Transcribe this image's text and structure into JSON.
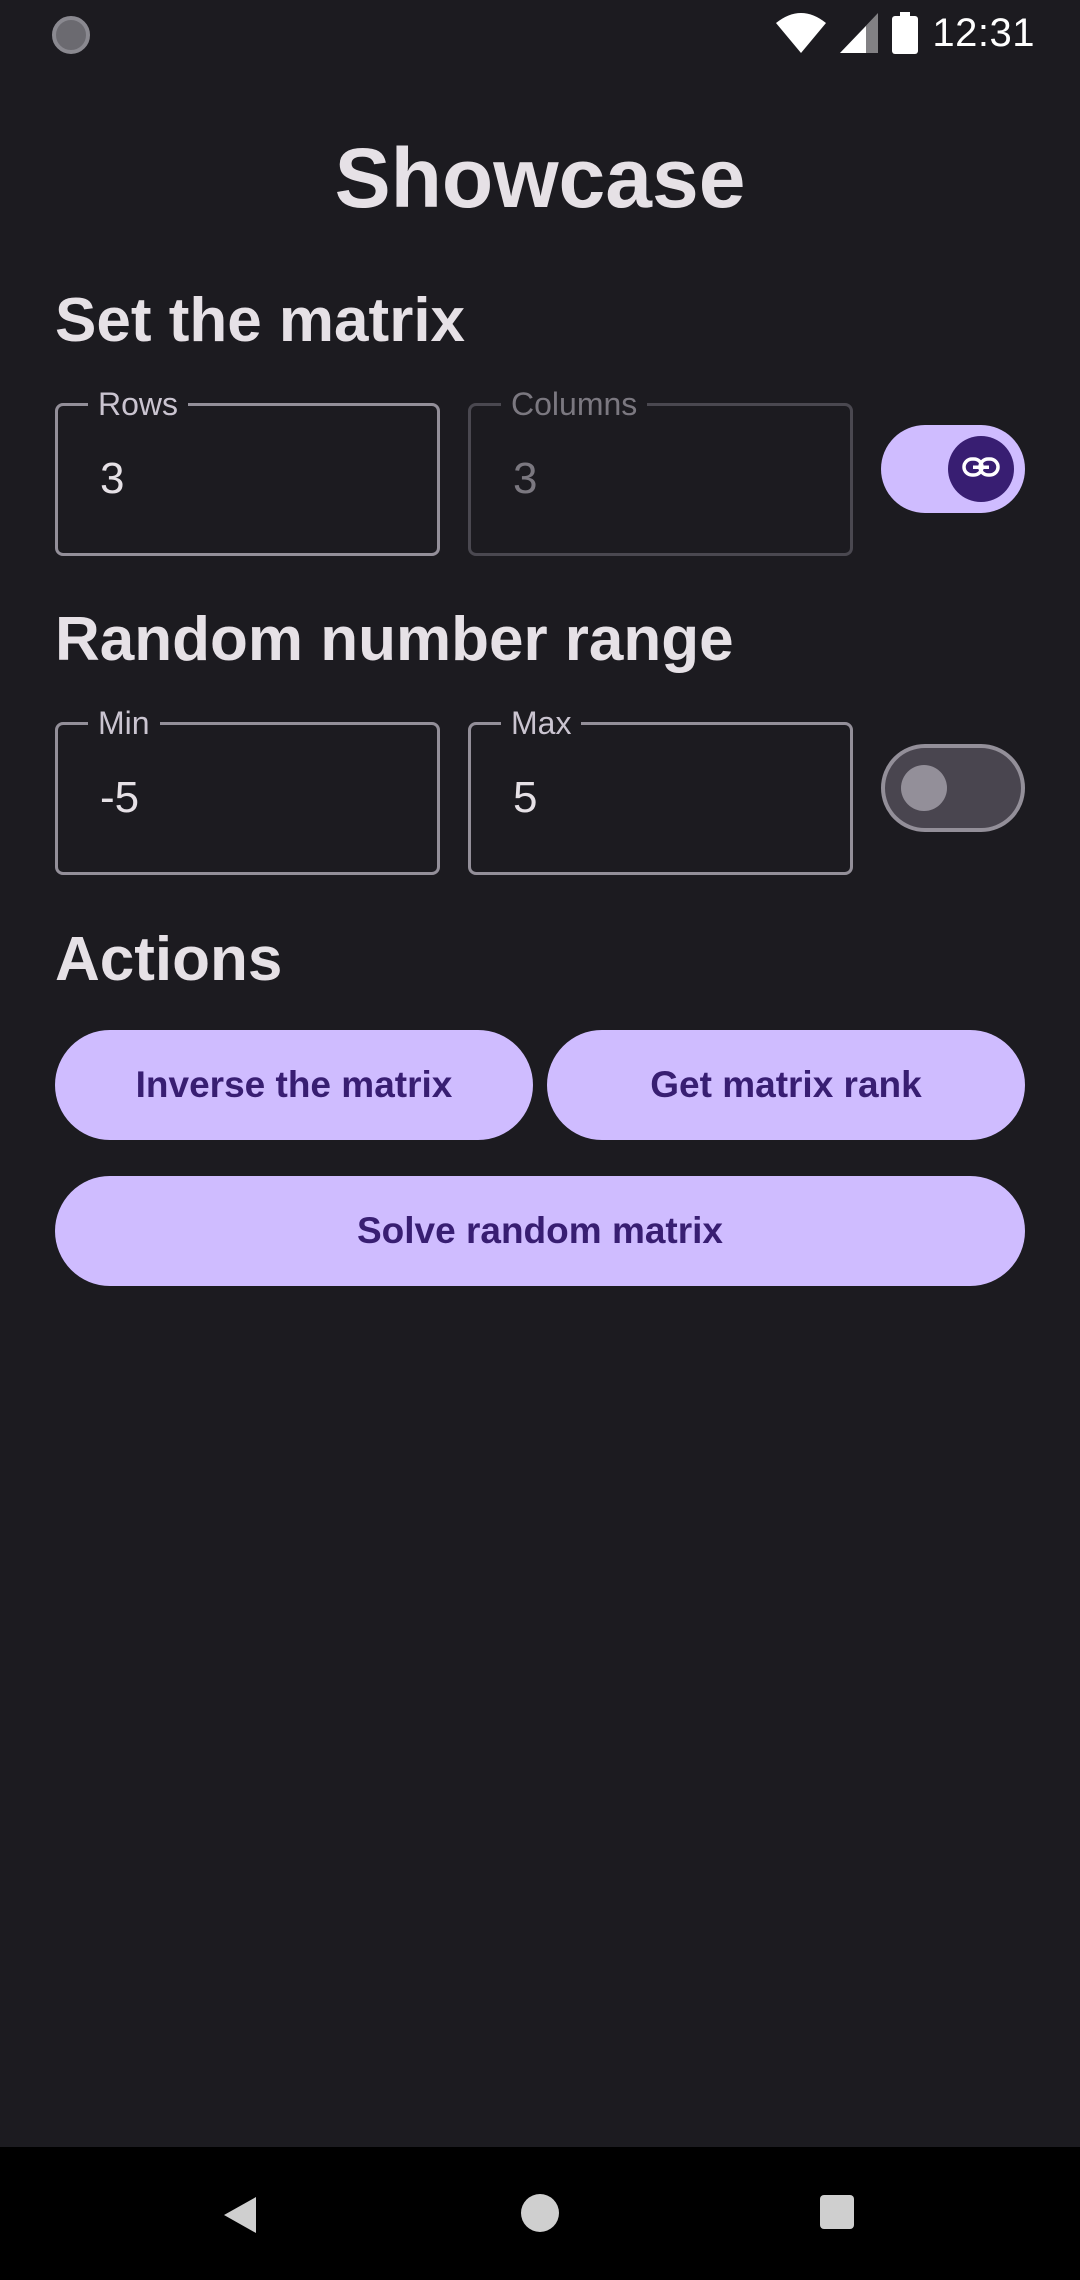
{
  "status_bar": {
    "time": "12:31",
    "icons": [
      "app-notification-icon",
      "wifi-icon",
      "cell-signal-icon",
      "battery-icon"
    ]
  },
  "app": {
    "title": "Showcase"
  },
  "matrix_section": {
    "title": "Set the matrix",
    "rows": {
      "label": "Rows",
      "value": "3"
    },
    "columns": {
      "label": "Columns",
      "value": "3",
      "enabled": false
    },
    "link_switch": {
      "checked": true,
      "icon": "link-icon"
    }
  },
  "range_section": {
    "title": "Random number range",
    "min": {
      "label": "Min",
      "value": "-5"
    },
    "max": {
      "label": "Max",
      "value": "5"
    },
    "range_switch": {
      "checked": false
    }
  },
  "actions_section": {
    "title": "Actions",
    "inverse_label": "Inverse the matrix",
    "rank_label": "Get matrix rank",
    "solve_label": "Solve random matrix"
  },
  "colors": {
    "background": "#1c1b20",
    "primary_container": "#cfbcff",
    "on_primary": "#381e72",
    "outline": "#938f99"
  }
}
